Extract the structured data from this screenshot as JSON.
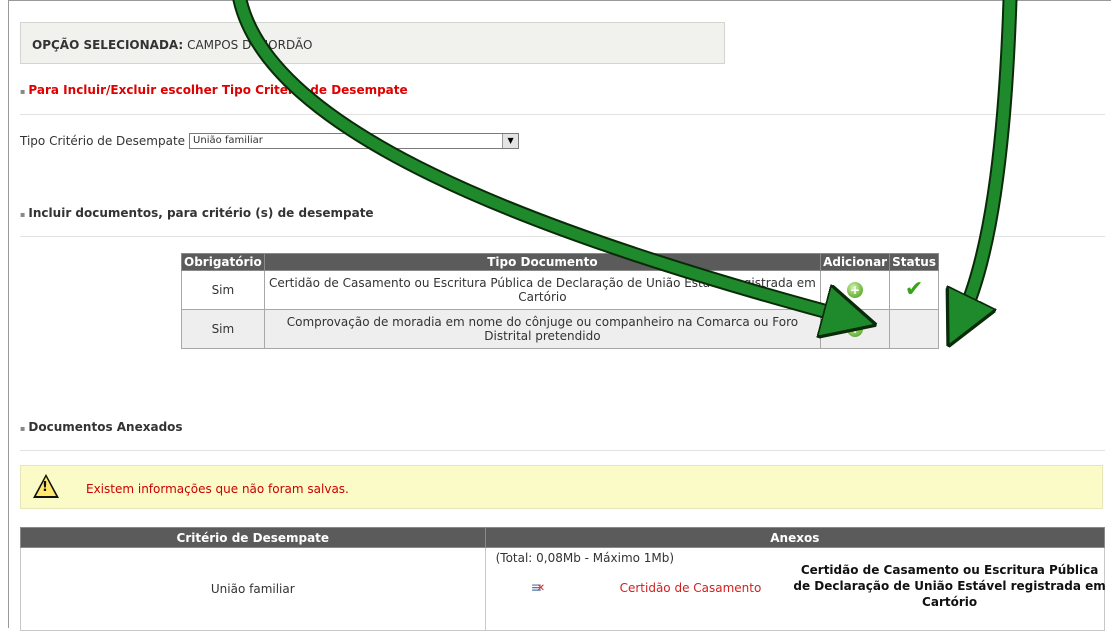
{
  "selected_option": {
    "label": "OPÇÃO SELECIONADA:",
    "value": "CAMPOS DO JORDÃO"
  },
  "section_tiebreak": {
    "title": "Para Incluir/Excluir escolher Tipo Critério de Desempate"
  },
  "criterio_field": {
    "label": "Tipo Critério de Desempate",
    "value": "União familiar"
  },
  "section_include_docs": {
    "title": "Incluir documentos, para critério (s) de desempate"
  },
  "docs_table": {
    "headers": [
      "Obrigatório",
      "Tipo Documento",
      "Adicionar",
      "Status"
    ],
    "rows": [
      {
        "obrigatorio": "Sim",
        "tipo": "Certidão de Casamento ou Escritura Pública de Declaração de União Estável registrada em Cartório",
        "status": "checked"
      },
      {
        "obrigatorio": "Sim",
        "tipo": "Comprovação de moradia em nome do cônjuge ou companheiro na Comarca ou Foro Distrital pretendido",
        "status": ""
      }
    ]
  },
  "section_attached": {
    "title": "Documentos Anexados"
  },
  "warning": {
    "text": "Existem informações que não foram salvas."
  },
  "attached_table": {
    "headers": [
      "Critério de Desempate",
      "Anexos"
    ],
    "row": {
      "criterio": "União familiar",
      "total": "(Total: 0,08Mb - Máximo 1Mb)",
      "file_link": "Certidão de Casamento",
      "file_desc": "Certidão de Casamento ou Escritura Pública de Declaração de União Estável registrada em Cartório"
    }
  },
  "icons": {
    "bullet": "square-bullet-icon",
    "select_arrow": "dropdown-arrow-icon",
    "add": "add-plus-icon",
    "status": "checkmark-icon",
    "warning": "warning-triangle-icon",
    "remove": "remove-file-icon"
  },
  "colors": {
    "header_bg": "#5b5b5b",
    "red_text": "#e00000",
    "annotation_arrow": "#1f8a2b",
    "warning_bg": "#fbfbc8"
  }
}
